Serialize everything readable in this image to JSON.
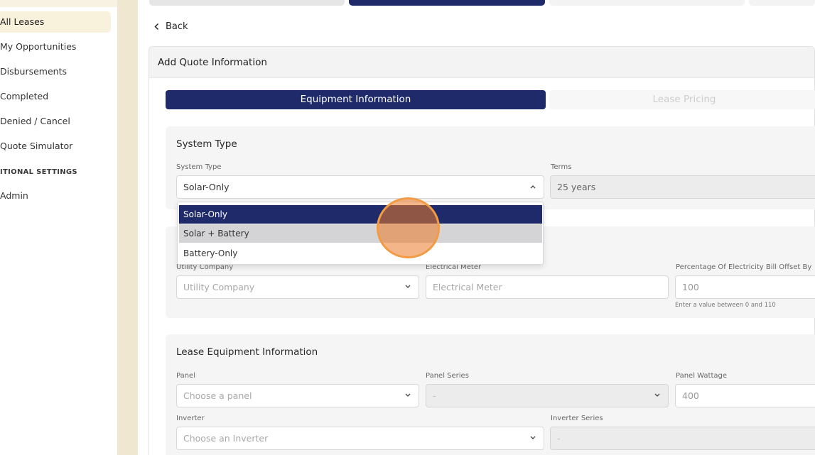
{
  "sidebar": {
    "items": [
      {
        "label": "All Leases",
        "active": true
      },
      {
        "label": "My Opportunities"
      },
      {
        "label": "Disbursements"
      },
      {
        "label": "Completed"
      },
      {
        "label": "Denied / Cancel"
      },
      {
        "label": "Quote Simulator"
      }
    ],
    "section_label": "ITIONAL SETTINGS",
    "admin_label": "Admin"
  },
  "back": {
    "label": "Back"
  },
  "card": {
    "title": "Add Quote Information"
  },
  "steps": {
    "active": "Equipment Information",
    "inactive": "Lease Pricing"
  },
  "system": {
    "title": "System Type",
    "type_label": "System Type",
    "type_value": "Solar-Only",
    "terms_label": "Terms",
    "terms_value": "25 years"
  },
  "dropdown": {
    "options": [
      "Solar-Only",
      "Solar + Battery",
      "Battery-Only"
    ],
    "selected": "Solar-Only"
  },
  "utility": {
    "company_label": "Utility Company",
    "company_placeholder": "Utility Company",
    "meter_label": "Electrical Meter",
    "meter_placeholder": "Electrical Meter",
    "offset_label": "Percentage Of Electricity Bill Offset By",
    "offset_value": "100",
    "offset_hint": "Enter a value between 0 and 110"
  },
  "equipment": {
    "title": "Lease Equipment Information",
    "panel_label": "Panel",
    "panel_placeholder": "Choose a panel",
    "series_label": "Panel Series",
    "series_value": "-",
    "wattage_label": "Panel Wattage",
    "wattage_value": "400",
    "inverter_label": "Inverter",
    "inverter_placeholder": "Choose an Inverter",
    "inverter_series_label": "Inverter Series",
    "inverter_series_value": "-"
  },
  "colors": {
    "primary": "#1f2a6b",
    "sidebar_active": "#f8f1dc",
    "click_indicator": "#f39a45"
  }
}
